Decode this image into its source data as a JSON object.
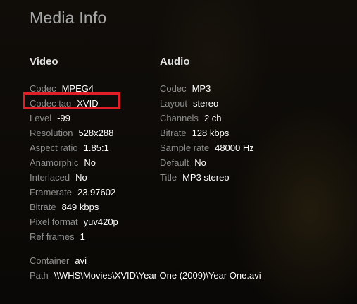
{
  "header": {
    "title": "Media Info"
  },
  "video": {
    "title": "Video",
    "rows": [
      {
        "label": "Codec",
        "value": "MPEG4"
      },
      {
        "label": "Codec tag",
        "value": "XVID"
      },
      {
        "label": "Level",
        "value": "-99"
      },
      {
        "label": "Resolution",
        "value": "528x288"
      },
      {
        "label": "Aspect ratio",
        "value": "1.85:1"
      },
      {
        "label": "Anamorphic",
        "value": "No"
      },
      {
        "label": "Interlaced",
        "value": "No"
      },
      {
        "label": "Framerate",
        "value": "23.97602"
      },
      {
        "label": "Bitrate",
        "value": "849 kbps"
      },
      {
        "label": "Pixel format",
        "value": "yuv420p"
      },
      {
        "label": "Ref frames",
        "value": "1"
      }
    ]
  },
  "audio": {
    "title": "Audio",
    "rows": [
      {
        "label": "Codec",
        "value": "MP3"
      },
      {
        "label": "Layout",
        "value": "stereo"
      },
      {
        "label": "Channels",
        "value": "2 ch"
      },
      {
        "label": "Bitrate",
        "value": "128 kbps"
      },
      {
        "label": "Sample rate",
        "value": "48000 Hz"
      },
      {
        "label": "Default",
        "value": "No"
      },
      {
        "label": "Title",
        "value": "MP3 stereo"
      }
    ]
  },
  "file": {
    "rows": [
      {
        "label": "Container",
        "value": "avi"
      },
      {
        "label": "Path",
        "value": "\\\\WHS\\Movies\\XVID\\Year One (2009)\\Year One.avi"
      }
    ]
  },
  "highlight_color": "#e01f26"
}
